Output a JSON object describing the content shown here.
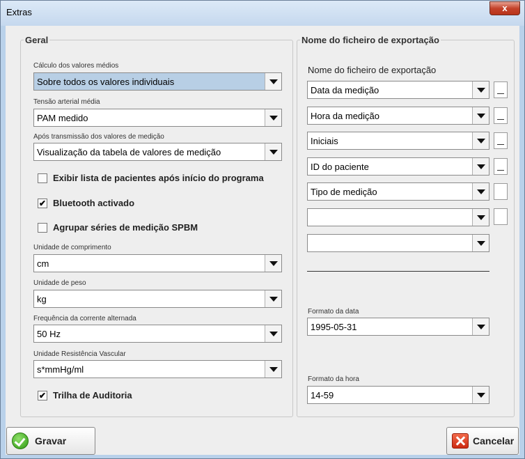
{
  "window": {
    "title": "Extras",
    "close_glyph": "x"
  },
  "geral": {
    "legend": "Geral",
    "fields": [
      {
        "label": "Cálculo dos valores médios",
        "value": "Sobre todos os valores individuais"
      },
      {
        "label": "Tensão arterial média",
        "value": "PAM medido"
      },
      {
        "label": "Após transmissão dos valores de medição",
        "value": "Visualização da tabela de valores de medição"
      }
    ],
    "checks": [
      {
        "label": "Exibir lista de pacientes após início do programa",
        "checked": false,
        "mark": ""
      },
      {
        "label": "Bluetooth activado",
        "checked": true,
        "mark": "✔"
      },
      {
        "label": "Agrupar séries de medição SPBM",
        "checked": false,
        "mark": ""
      }
    ],
    "units": [
      {
        "label": "Unidade de comprimento",
        "value": "cm"
      },
      {
        "label": "Unidade de peso",
        "value": "kg"
      },
      {
        "label": "Frequência da corrente alternada",
        "value": "50 Hz"
      },
      {
        "label": "Unidade Resistência Vascular",
        "value": "s*mmHg/ml"
      }
    ],
    "audit": {
      "label": "Trilha de Auditoria",
      "checked": true,
      "mark": "✔"
    }
  },
  "export": {
    "legend": "Nome do ficheiro de exportação",
    "heading": "Nome do ficheiro de exportação",
    "items": [
      {
        "value": "Data da medição",
        "button": "_"
      },
      {
        "value": "Hora da medição",
        "button": "_"
      },
      {
        "value": "Iniciais",
        "button": "_"
      },
      {
        "value": "ID do paciente",
        "button": "_"
      },
      {
        "value": "Tipo de medição",
        "button": ""
      },
      {
        "value": "",
        "button": ""
      },
      {
        "value": ""
      }
    ],
    "date_format": {
      "label": "Formato da data",
      "value": "1995-05-31"
    },
    "time_format": {
      "label": "Formato da hora",
      "value": "14-59"
    }
  },
  "buttons": {
    "save": "Gravar",
    "cancel": "Cancelar"
  },
  "colors": {
    "selected_combo": "#b8cfe5",
    "window_frame": "#b9d1ea"
  }
}
